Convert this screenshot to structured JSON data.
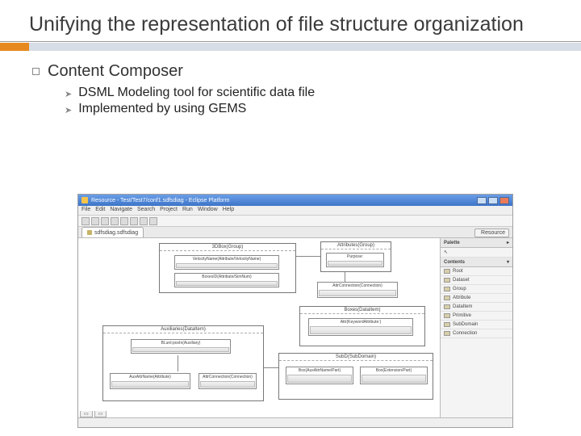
{
  "slide": {
    "title": "Unifying the representation of file structure organization",
    "heading": "Content Composer",
    "bullets": [
      "DSML Modeling tool for scientific data file",
      "Implemented by using GEMS"
    ]
  },
  "ide": {
    "window_title": "Resource - Test/Test7/conf1.sdfsdiag - Eclipse Platform",
    "menu": [
      "File",
      "Edit",
      "Navigate",
      "Search",
      "Project",
      "Run",
      "Window",
      "Help"
    ],
    "tab": "sdfsdiag.sdfsdiag",
    "perspective": "Resource",
    "palette": {
      "title": "Palette",
      "section": "Contents",
      "items": [
        "Root",
        "Dataset",
        "Group",
        "Attribute",
        "DataItem",
        "Primitive",
        "SubDomain",
        "Connection"
      ]
    },
    "diagram": {
      "groups": [
        {
          "id": "g1",
          "label": "3DBox(Group)"
        },
        {
          "id": "g2",
          "label": "Attributes(Group)"
        },
        {
          "id": "g3",
          "label": "Auxiliaries(DataItem)"
        },
        {
          "id": "g4",
          "label": "Boxes(DataItem)"
        },
        {
          "id": "g5",
          "label": "SubD(SubDomain)"
        }
      ],
      "nodes": [
        {
          "label": "VelocityName(Attribute/VelocityName)"
        },
        {
          "label": "BoxesID(Attribute/SimNum)"
        },
        {
          "label": "Purpose:"
        },
        {
          "label": "AttrConnection(Connection)"
        },
        {
          "label": "BLunt:posIn(Auxiliary)"
        },
        {
          "label": "AuxAttrName(Attribute)"
        },
        {
          "label": "Box(AuxAttrName/Part)"
        },
        {
          "label": "Box(Extension/Part)"
        },
        {
          "label": "AttrConnection(Connection)"
        },
        {
          "label": "Attr(KeywordAttribute:)"
        }
      ]
    }
  }
}
